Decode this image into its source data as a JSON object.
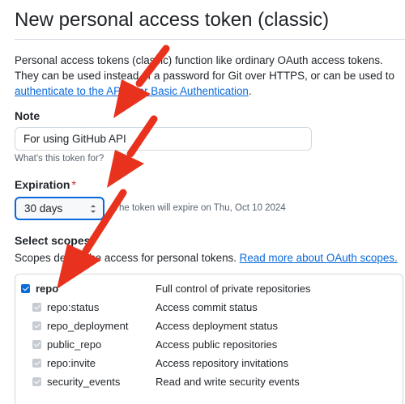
{
  "header": {
    "title": "New personal access token (classic)"
  },
  "intro": {
    "text_1": "Personal access tokens (classic) function like ordinary OAuth access tokens. They can be used instead of a password for Git over HTTPS, or can be used to ",
    "link": "authenticate to the API over Basic Authentication",
    "text_2": "."
  },
  "note": {
    "label": "Note",
    "value": "For using GitHub API",
    "hint": "What's this token for?"
  },
  "expiration": {
    "label": "Expiration",
    "required_mark": "*",
    "selected": "30 days",
    "note": "The token will expire on Thu, Oct 10 2024"
  },
  "scopes": {
    "label": "Select scopes",
    "description": "Scopes define the access for personal tokens. ",
    "link": "Read more about OAuth scopes.",
    "items": [
      {
        "name": "repo",
        "description": "Full control of private repositories",
        "checked": true,
        "parent": true
      },
      {
        "name": "repo:status",
        "description": "Access commit status",
        "checked": true,
        "parent": false
      },
      {
        "name": "repo_deployment",
        "description": "Access deployment status",
        "checked": true,
        "parent": false
      },
      {
        "name": "public_repo",
        "description": "Access public repositories",
        "checked": true,
        "parent": false
      },
      {
        "name": "repo:invite",
        "description": "Access repository invitations",
        "checked": true,
        "parent": false
      },
      {
        "name": "security_events",
        "description": "Read and write security events",
        "checked": true,
        "parent": false
      }
    ]
  },
  "colors": {
    "accent": "#0969da",
    "required": "#cf222e",
    "annotation_arrow": "#e8321e"
  },
  "icons": {
    "select": "chevron-up-down-icon",
    "annotation": "arrow-annotation-icon"
  }
}
